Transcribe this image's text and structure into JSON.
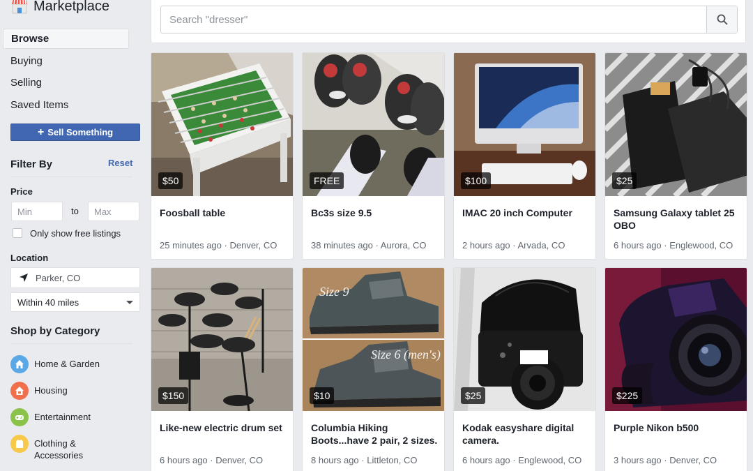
{
  "brand": {
    "title": "Marketplace"
  },
  "nav": [
    {
      "label": "Browse"
    },
    {
      "label": "Buying"
    },
    {
      "label": "Selling"
    },
    {
      "label": "Saved Items"
    }
  ],
  "sell_button": {
    "label": "Sell Something"
  },
  "filters": {
    "heading": "Filter By",
    "reset": "Reset",
    "price_label": "Price",
    "min_placeholder": "Min",
    "to": "to",
    "max_placeholder": "Max",
    "free_only": "Only show free listings",
    "location_label": "Location",
    "location_value": "Parker, CO",
    "distance": "Within 40 miles"
  },
  "categories": {
    "heading": "Shop by Category",
    "items": [
      {
        "label": "Home & Garden",
        "icon": "home-garden-icon",
        "color": "#5aa9e6"
      },
      {
        "label": "Housing",
        "icon": "housing-icon",
        "color": "#f0704d"
      },
      {
        "label": "Entertainment",
        "icon": "entertainment-icon",
        "color": "#8bc34a"
      },
      {
        "label": "Clothing & Accessories",
        "icon": "clothing-icon",
        "color": "#f7c94b"
      }
    ]
  },
  "search": {
    "placeholder": "Search \"dresser\""
  },
  "listings": [
    {
      "price": "$50",
      "title": "Foosball table",
      "time": "25 minutes ago",
      "place": "Denver, CO"
    },
    {
      "price": "FREE",
      "title": "Bc3s size 9.5",
      "time": "38 minutes ago",
      "place": "Aurora, CO"
    },
    {
      "price": "$100",
      "title": "IMAC 20 inch Computer",
      "time": "2 hours ago",
      "place": "Arvada, CO"
    },
    {
      "price": "$25",
      "title": "Samsung Galaxy tablet 25 OBO",
      "time": "6 hours ago",
      "place": "Englewood, CO"
    },
    {
      "price": "$150",
      "title": "Like-new electric drum set",
      "time": "6 hours ago",
      "place": "Denver, CO"
    },
    {
      "price": "$10",
      "title": "Columbia Hiking Boots...have 2 pair, 2 sizes.",
      "time": "8 hours ago",
      "place": "Littleton, CO",
      "photo_text": [
        "Size 9",
        "Size 6 (men's)"
      ]
    },
    {
      "price": "$25",
      "title": "Kodak easyshare digital camera.",
      "time": "6 hours ago",
      "place": "Englewood, CO"
    },
    {
      "price": "$225",
      "title": "Purple Nikon b500",
      "time": "3 hours ago",
      "place": "Denver, CO"
    }
  ],
  "meta_separator": " · ",
  "colors": {
    "accent": "#4267b2",
    "background": "#e9ebee"
  }
}
